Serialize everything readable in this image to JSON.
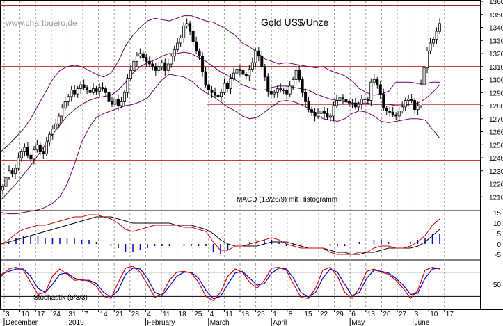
{
  "chart_data": [
    {
      "type": "candlestick",
      "title": "Gold US$/Unze",
      "watermark": "www.chartbuero.de",
      "ylim": [
        1200,
        1360
      ],
      "yticks": [
        1210,
        1220,
        1230,
        1240,
        1250,
        1260,
        1270,
        1280,
        1290,
        1300,
        1310,
        1320,
        1330,
        1340,
        1350,
        1360
      ],
      "horizontal_lines": [
        {
          "value": 1357
        },
        {
          "value": 1310
        },
        {
          "value": 1281
        },
        {
          "value": 1238
        }
      ],
      "candles_close": [
        1218,
        1225,
        1230,
        1228,
        1232,
        1240,
        1245,
        1248,
        1242,
        1239,
        1246,
        1250,
        1245,
        1243,
        1252,
        1258,
        1262,
        1266,
        1272,
        1278,
        1283,
        1287,
        1292,
        1289,
        1293,
        1296,
        1294,
        1292,
        1290,
        1293,
        1291,
        1294,
        1293,
        1290,
        1283,
        1281,
        1285,
        1280,
        1283,
        1290,
        1301,
        1307,
        1314,
        1318,
        1320,
        1317,
        1314,
        1312,
        1310,
        1307,
        1310,
        1313,
        1307,
        1312,
        1318,
        1323,
        1328,
        1332,
        1341,
        1343,
        1337,
        1329,
        1322,
        1318,
        1306,
        1296,
        1292,
        1290,
        1288,
        1287,
        1290,
        1297,
        1293,
        1301,
        1305,
        1308,
        1307,
        1304,
        1303,
        1308,
        1313,
        1322,
        1318,
        1310,
        1302,
        1291,
        1289,
        1290,
        1293,
        1292,
        1292,
        1289,
        1295,
        1300,
        1307,
        1300,
        1290,
        1283,
        1277,
        1275,
        1272,
        1274,
        1276,
        1274,
        1271,
        1272,
        1280,
        1284,
        1286,
        1285,
        1283,
        1282,
        1282,
        1279,
        1281,
        1285,
        1285,
        1284,
        1298,
        1300,
        1296,
        1289,
        1278,
        1276,
        1275,
        1273,
        1272,
        1276,
        1279,
        1284,
        1285,
        1284,
        1277,
        1280,
        1296,
        1309,
        1322,
        1328,
        1331,
        1337,
        1343
      ],
      "bollinger_upper": [
        1245,
        1250,
        1256,
        1262,
        1270,
        1280,
        1290,
        1300,
        1307,
        1310,
        1311,
        1310,
        1307,
        1304,
        1302,
        1305,
        1314,
        1326,
        1334,
        1340,
        1345,
        1347,
        1346,
        1345,
        1347,
        1349,
        1349,
        1347,
        1345,
        1344,
        1341,
        1338,
        1334,
        1328,
        1325,
        1321,
        1316,
        1314,
        1312,
        1313,
        1312,
        1311,
        1310,
        1309,
        1310,
        1307,
        1305,
        1303,
        1299,
        1293,
        1290,
        1288,
        1289,
        1291,
        1298,
        1298,
        1298,
        1297,
        1297,
        1298,
        1298
      ],
      "bollinger_middle": [
        1208,
        1214,
        1220,
        1227,
        1234,
        1242,
        1250,
        1258,
        1265,
        1272,
        1277,
        1281,
        1284,
        1286,
        1287,
        1288,
        1292,
        1298,
        1305,
        1310,
        1313,
        1315,
        1318,
        1320,
        1320,
        1321,
        1320,
        1317,
        1314,
        1310,
        1306,
        1303,
        1300,
        1296,
        1294,
        1292,
        1292,
        1294,
        1295,
        1295,
        1294,
        1293,
        1292,
        1289,
        1287,
        1285,
        1284,
        1283,
        1282,
        1282,
        1282,
        1281,
        1281,
        1281,
        1280,
        1280,
        1281,
        1282,
        1285,
        1290,
        1296
      ],
      "bollinger_lower": [
        1198,
        1197,
        1197,
        1198,
        1199,
        1200,
        1202,
        1205,
        1210,
        1220,
        1235,
        1252,
        1263,
        1271,
        1274,
        1276,
        1278,
        1280,
        1281,
        1283,
        1286,
        1293,
        1300,
        1304,
        1303,
        1302,
        1299,
        1294,
        1290,
        1287,
        1283,
        1279,
        1276,
        1272,
        1270,
        1271,
        1275,
        1279,
        1283,
        1284,
        1283,
        1281,
        1278,
        1274,
        1270,
        1269,
        1268,
        1270,
        1274,
        1276,
        1275,
        1272,
        1268,
        1267,
        1268,
        1269,
        1270,
        1270,
        1269,
        1262,
        1255
      ]
    },
    {
      "type": "line",
      "title": "MACD (12/26/9) mit Histogramm",
      "ylim": [
        -7,
        16
      ],
      "yticks": [
        15,
        10,
        5,
        0,
        -5
      ],
      "macd": [
        0,
        2,
        5,
        7,
        8,
        9,
        9,
        10,
        11,
        12,
        13,
        13,
        14,
        14,
        13,
        12,
        10,
        7,
        6,
        7,
        8,
        9,
        9,
        9,
        9,
        8,
        8,
        7,
        6,
        1,
        -3,
        -3,
        -1,
        -1,
        0,
        1,
        2,
        3,
        2,
        0,
        -1,
        -2,
        -2,
        -2,
        -2,
        -4,
        -5,
        -5,
        -5,
        -4,
        -4,
        -2,
        -1,
        -1,
        -2,
        -2,
        -1,
        1,
        4,
        9,
        12
      ],
      "signal": [
        0,
        1,
        2,
        3,
        4,
        5,
        6,
        7,
        8,
        9,
        10,
        11,
        12,
        13,
        13,
        13,
        12,
        11,
        10,
        10,
        10,
        10,
        10,
        10,
        9,
        9,
        9,
        8,
        7,
        5,
        2,
        0,
        -1,
        -1,
        -1,
        -1,
        0,
        1,
        1,
        1,
        0,
        -1,
        -2,
        -2,
        -2,
        -3,
        -4,
        -4,
        -5,
        -5,
        -4,
        -4,
        -3,
        -2,
        -2,
        -2,
        -2,
        -1,
        1,
        4,
        7
      ]
    },
    {
      "type": "line",
      "title": "Stochastik (5/3/3)",
      "reference_lines": [
        {
          "value": 80
        },
        {
          "value": 20
        }
      ],
      "ytick": "50",
      "k": [
        70,
        88,
        92,
        85,
        55,
        25,
        30,
        70,
        88,
        75,
        60,
        62,
        58,
        45,
        20,
        15,
        55,
        90,
        95,
        80,
        50,
        18,
        25,
        60,
        80,
        82,
        78,
        55,
        20,
        10,
        30,
        70,
        88,
        80,
        55,
        40,
        60,
        90,
        92,
        85,
        50,
        18,
        15,
        40,
        85,
        92,
        70,
        30,
        15,
        40,
        82,
        88,
        80,
        75,
        60,
        40,
        15,
        35,
        85,
        92,
        88
      ],
      "d": [
        75,
        82,
        88,
        88,
        70,
        40,
        30,
        50,
        75,
        78,
        65,
        60,
        60,
        52,
        30,
        18,
        35,
        75,
        90,
        88,
        65,
        30,
        22,
        45,
        70,
        80,
        80,
        65,
        35,
        15,
        20,
        50,
        78,
        82,
        65,
        48,
        52,
        78,
        90,
        88,
        65,
        30,
        18,
        30,
        65,
        88,
        80,
        50,
        22,
        30,
        65,
        85,
        82,
        78,
        65,
        48,
        25,
        28,
        65,
        88,
        90
      ]
    }
  ],
  "x_axis": {
    "day_labels": [
      "3",
      "10",
      "17",
      "24",
      "31",
      "7",
      "14",
      "21",
      "28",
      "4",
      "11",
      "18",
      "25",
      "4",
      "11",
      "18",
      "25",
      "1",
      "8",
      "15",
      "22",
      "29",
      "6",
      "13",
      "20",
      "27",
      "3",
      "10",
      "17"
    ],
    "month_labels": [
      "December",
      "2019",
      "February",
      "March",
      "April",
      "May",
      "June"
    ]
  },
  "colors": {
    "grid": "#999999",
    "price": "#000000",
    "bollinger": "#660066",
    "horizontal_line": "#b00000",
    "macd_line": "#cc0000",
    "signal_line": "#000000",
    "histogram": "#0000cc",
    "stoch_k": "#cc0000",
    "stoch_d": "#0000cc",
    "watermark": "#999999"
  }
}
